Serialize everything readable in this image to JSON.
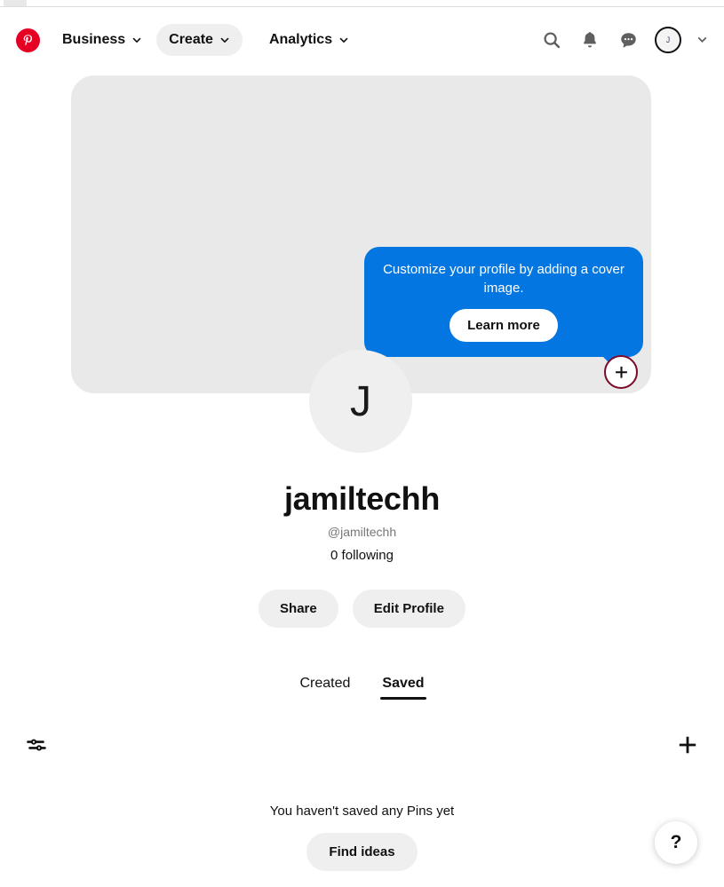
{
  "browser": {
    "tab_strip": ""
  },
  "header": {
    "logo": "pinterest-logo",
    "nav": [
      {
        "label": "Business",
        "icon": "chevron-down-icon",
        "active": false
      },
      {
        "label": "Create",
        "icon": "chevron-down-icon",
        "active": true
      },
      {
        "label": "Analytics",
        "icon": "chevron-down-icon",
        "active": false
      }
    ],
    "actions": [
      {
        "icon": "search-icon",
        "name": "search-button"
      },
      {
        "icon": "bell-icon",
        "name": "notifications-button"
      },
      {
        "icon": "message-bubble-icon",
        "name": "messages-button"
      }
    ],
    "avatar_initial": "J",
    "account_chevron": "chevron-down-icon"
  },
  "cover": {
    "placeholder_color": "#e9e9e9",
    "add_cover_label": "+",
    "tooltip": {
      "text": "Customize your profile by adding a cover image.",
      "button_label": "Learn more",
      "background": "#0476e1"
    }
  },
  "profile": {
    "avatar_initial": "J",
    "name": "jamiltechh",
    "handle": "@jamiltechh",
    "following": "0 following",
    "share_label": "Share",
    "edit_label": "Edit Profile"
  },
  "tabs": [
    {
      "label": "Created",
      "active": false
    },
    {
      "label": "Saved",
      "active": true
    }
  ],
  "toolbar": {
    "filter_icon": "sliders-icon",
    "add_icon": "plus-icon"
  },
  "empty_state": {
    "message": "You haven't saved any Pins yet",
    "button_label": "Find ideas"
  },
  "help": {
    "label": "?"
  },
  "colors": {
    "brand_red": "#e60023",
    "tooltip_blue": "#0476e1",
    "cover_gray": "#e9e9e9",
    "pill_gray": "#efefef",
    "accent_maroon": "#7c0a28"
  }
}
